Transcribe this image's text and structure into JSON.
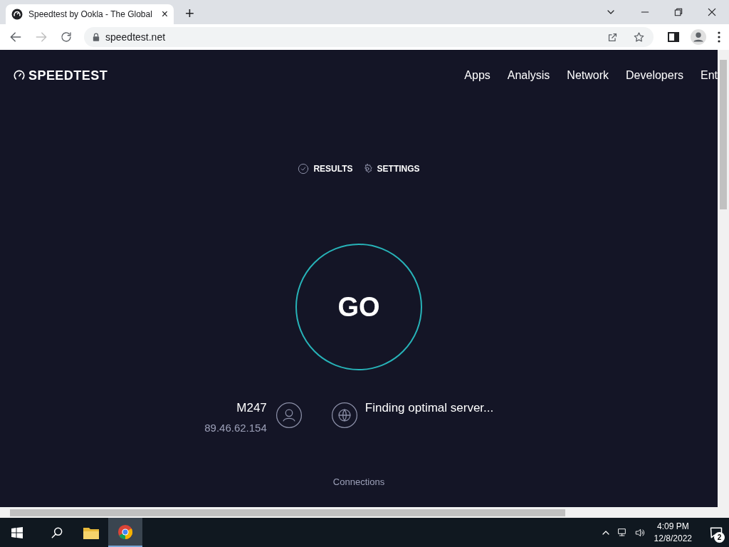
{
  "browser": {
    "tab": {
      "title": "Speedtest by Ookla - The Global",
      "close": "×",
      "selected": true
    },
    "new_tab": "+",
    "url": "speedtest.net"
  },
  "page": {
    "logo": "SPEEDTEST",
    "nav": [
      "Apps",
      "Analysis",
      "Network",
      "Developers",
      "Ent"
    ],
    "links": [
      {
        "kind": "results",
        "label": "RESULTS"
      },
      {
        "kind": "settings",
        "label": "SETTINGS"
      }
    ],
    "go_button": "GO",
    "provider": {
      "name": "M247",
      "ip": "89.46.62.154"
    },
    "server": {
      "status": "Finding optimal server..."
    },
    "connections": {
      "label": "Connections"
    }
  },
  "taskbar": {
    "apps": [
      {
        "kind": "search",
        "selected": false
      },
      {
        "kind": "explorer",
        "selected": false
      },
      {
        "kind": "chrome",
        "selected": true
      }
    ],
    "time": "4:09 PM",
    "date": "12/8/2022",
    "notifications": "2"
  }
}
